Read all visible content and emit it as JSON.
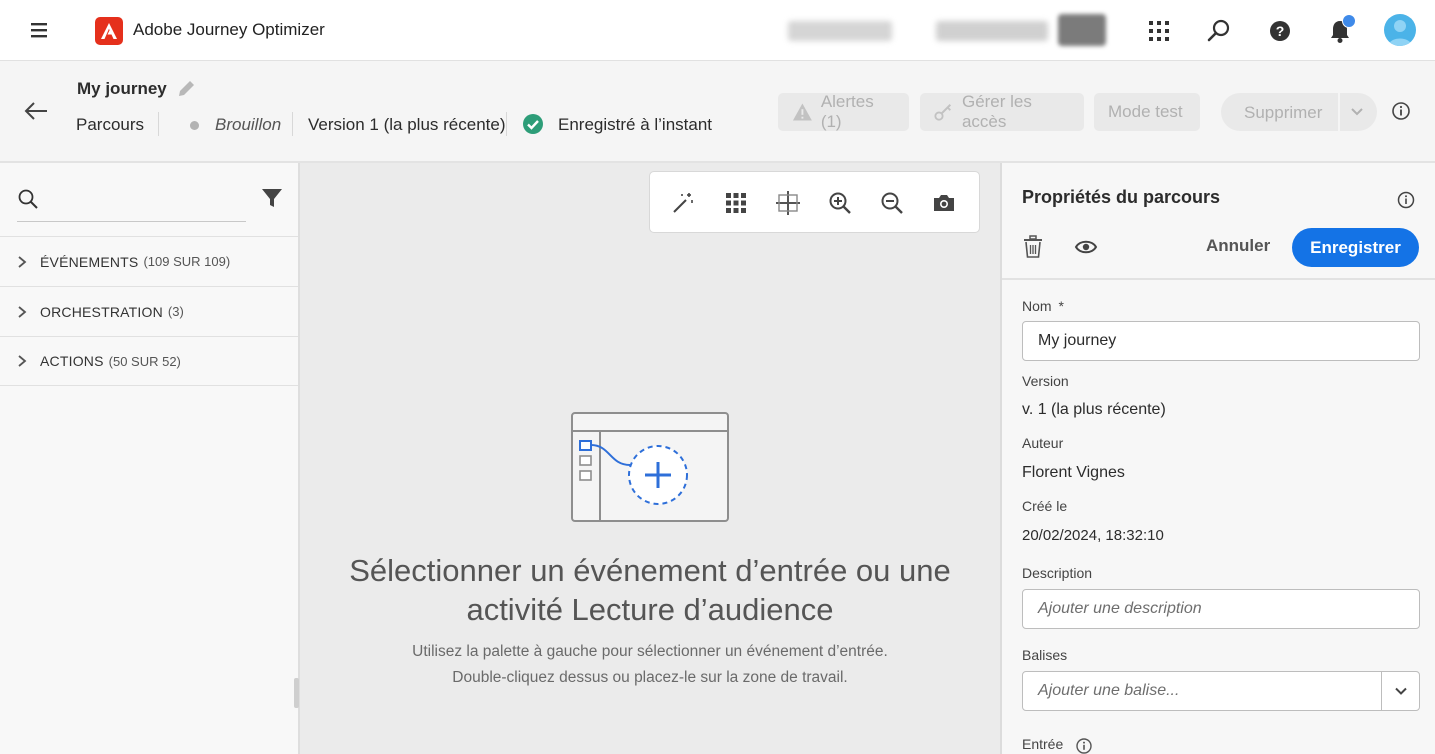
{
  "topbar": {
    "app_title": "Adobe Journey Optimizer",
    "icons": [
      "menu-icon",
      "adobe-logo",
      "apps-grid-icon",
      "search-icon",
      "help-icon",
      "notification-bell-icon",
      "avatar"
    ]
  },
  "journey": {
    "name": "My journey",
    "breadcrumb": "Parcours",
    "status": "Brouillon",
    "version": "Version 1 (la plus récente)",
    "saved_status": "Enregistré à l’instant",
    "buttons": {
      "alerts": "Alertes (1)",
      "manage_access": "Gérer les accès",
      "test_mode": "Mode test",
      "delete": "Supprimer"
    }
  },
  "palette": {
    "search_placeholder": "",
    "categories": [
      {
        "name": "ÉVÉNEMENTS",
        "count": "(109 SUR 109)"
      },
      {
        "name": "ORCHESTRATION",
        "count": "(3)"
      },
      {
        "name": "ACTIONS",
        "count": "(50 SUR 52)"
      }
    ]
  },
  "canvas": {
    "empty_title": "Sélectionner un événement d’entrée ou une activité Lecture d’audience",
    "empty_subtitle_line1": "Utilisez la palette à gauche pour sélectionner un événement d’entrée.",
    "empty_subtitle_line2": "Double-cliquez dessus ou placez-le sur la zone de travail.",
    "toolbar_icons": [
      "magic-wand-icon",
      "grid-icon",
      "align-icon",
      "zoom-in-icon",
      "zoom-out-icon",
      "camera-icon"
    ]
  },
  "properties": {
    "title": "Propriétés du parcours",
    "cancel": "Annuler",
    "save": "Enregistrer",
    "name_label": "Nom",
    "required_mark": "*",
    "name_value": "My journey",
    "version_label": "Version",
    "version_value": "v. 1 (la plus récente)",
    "author_label": "Auteur",
    "author_value": "Florent Vignes",
    "created_label": "Créé le",
    "created_value": "20/02/2024, 18:32:10",
    "description_label": "Description",
    "description_placeholder": "Ajouter une description",
    "tags_label": "Balises",
    "tags_placeholder": "Ajouter une balise...",
    "entry_label": "Entrée"
  },
  "colors": {
    "accent": "#1473e6",
    "adobe_red": "#e5301c",
    "success": "#2d9d78"
  }
}
